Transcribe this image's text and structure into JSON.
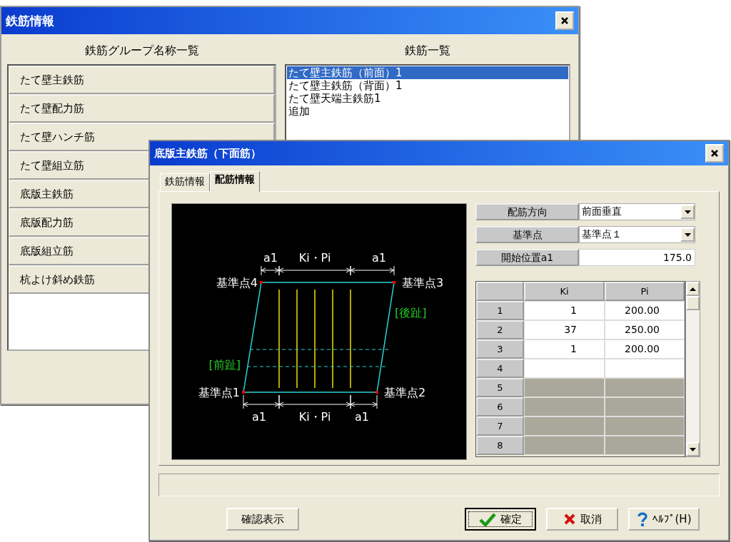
{
  "back_window": {
    "title": "鉄筋情報",
    "group_list": {
      "heading": "鉄筋グループ名称一覧",
      "items": [
        {
          "label": "たて壁主鉄筋",
          "selected": false
        },
        {
          "label": "たて壁配力筋",
          "selected": false
        },
        {
          "label": "たて壁ハンチ筋",
          "selected": false
        },
        {
          "label": "たて壁組立筋",
          "selected": false
        },
        {
          "label": "底版主鉄筋",
          "selected": false
        },
        {
          "label": "底版配力筋",
          "selected": false
        },
        {
          "label": "底版組立筋",
          "selected": false
        },
        {
          "label": "杭よけ斜め鉄筋",
          "selected": false
        }
      ]
    },
    "rebar_list": {
      "heading": "鉄筋一覧",
      "items": [
        {
          "label": "たて壁主鉄筋（前面）1",
          "selected": true
        },
        {
          "label": "たて壁主鉄筋（背面）1",
          "selected": false
        },
        {
          "label": "たて壁天端主鉄筋1",
          "selected": false
        },
        {
          "label": "追加",
          "selected": false
        }
      ]
    }
  },
  "front_window": {
    "title": "底版主鉄筋（下面筋）",
    "tabs": [
      {
        "label": "鉄筋情報",
        "selected": false
      },
      {
        "label": "配筋情報",
        "selected": true
      }
    ],
    "diagram": {
      "dimension_top": [
        "a1",
        "Ki・Pi",
        "a1"
      ],
      "dimension_bottom": [
        "a1",
        "Ki・Pi",
        "a1"
      ],
      "reference_points": [
        "基準点1",
        "基準点2",
        "基準点3",
        "基準点4"
      ],
      "zone_labels": [
        "[後趾]",
        "[前趾]"
      ]
    },
    "fields": [
      {
        "label": "配筋方向",
        "kind": "dropdown",
        "value": "前面垂直"
      },
      {
        "label": "基準点",
        "kind": "dropdown",
        "value": "基準点１"
      },
      {
        "label": "開始位置a1",
        "kind": "number",
        "value": "175.0"
      }
    ],
    "table": {
      "columns": [
        "Ki",
        "Pi"
      ],
      "rows": [
        {
          "label": "1",
          "ki": "1",
          "pi": "200.00",
          "enabled": true
        },
        {
          "label": "2",
          "ki": "37",
          "pi": "250.00",
          "enabled": true
        },
        {
          "label": "3",
          "ki": "1",
          "pi": "200.00",
          "enabled": true
        },
        {
          "label": "4",
          "enabled": true
        },
        {
          "label": "5",
          "enabled": false
        },
        {
          "label": "6",
          "enabled": false
        },
        {
          "label": "7",
          "enabled": false
        },
        {
          "label": "8",
          "enabled": false
        }
      ]
    },
    "buttons": [
      {
        "label": "確認表示",
        "kind": "plain",
        "focused": false
      },
      {
        "label": "確定",
        "kind": "confirm",
        "focused": true
      },
      {
        "label": "取消",
        "kind": "cancel",
        "focused": false
      },
      {
        "label": "ﾍﾙﾌﾟ(H)",
        "kind": "help",
        "focused": false
      }
    ]
  }
}
